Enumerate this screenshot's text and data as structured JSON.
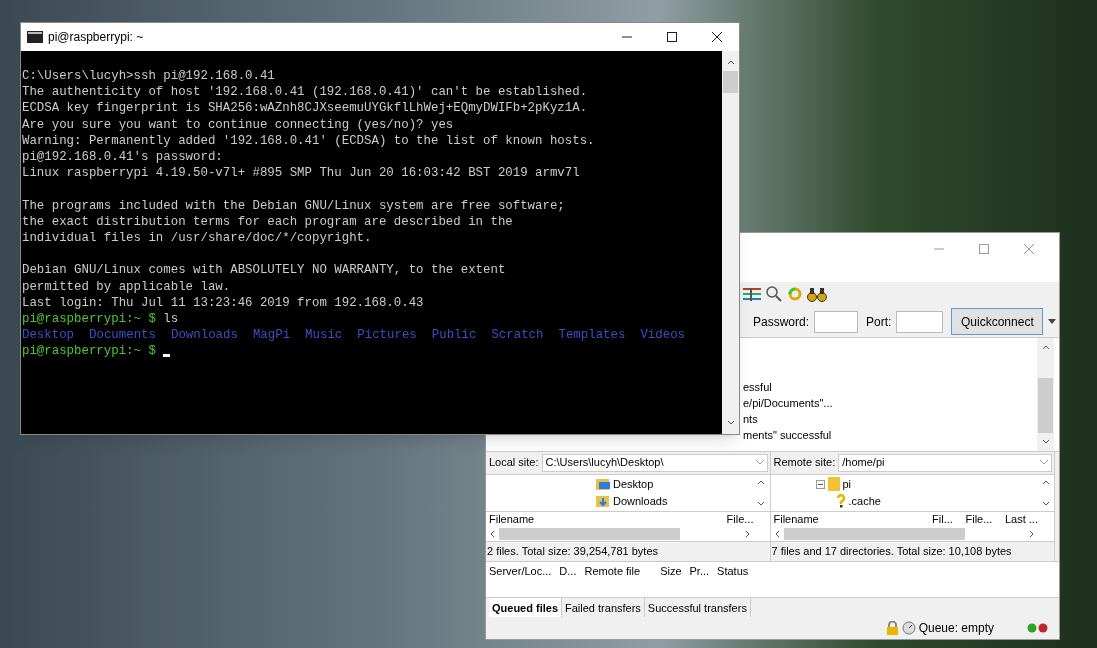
{
  "terminal": {
    "title": "pi@raspberrypi: ~",
    "lines": [
      {
        "kind": "output",
        "text": "C:\\Users\\lucyh>ssh pi@192.168.0.41"
      },
      {
        "kind": "output",
        "text": "The authenticity of host '192.168.0.41 (192.168.0.41)' can't be established."
      },
      {
        "kind": "output",
        "text": "ECDSA key fingerprint is SHA256:wAZnh8CJXseemuUYGkflLhWej+EQmyDWIFb+2pKyz1A."
      },
      {
        "kind": "output",
        "text": "Are you sure you want to continue connecting (yes/no)? yes"
      },
      {
        "kind": "output",
        "text": "Warning: Permanently added '192.168.0.41' (ECDSA) to the list of known hosts."
      },
      {
        "kind": "output",
        "text": "pi@192.168.0.41's password:"
      },
      {
        "kind": "output",
        "text": "Linux raspberrypi 4.19.50-v7l+ #895 SMP Thu Jun 20 16:03:42 BST 2019 armv7l"
      },
      {
        "kind": "blank"
      },
      {
        "kind": "output",
        "text": "The programs included with the Debian GNU/Linux system are free software;"
      },
      {
        "kind": "output",
        "text": "the exact distribution terms for each program are described in the"
      },
      {
        "kind": "output",
        "text": "individual files in /usr/share/doc/*/copyright."
      },
      {
        "kind": "blank"
      },
      {
        "kind": "output",
        "text": "Debian GNU/Linux comes with ABSOLUTELY NO WARRANTY, to the extent"
      },
      {
        "kind": "output",
        "text": "permitted by applicable law."
      },
      {
        "kind": "output",
        "text": "Last login: Thu Jul 11 13:23:46 2019 from 192.168.0.43"
      },
      {
        "kind": "prompt",
        "prompt": "pi@raspberrypi:~ $",
        "command": "ls",
        "cursor": false
      },
      {
        "kind": "listing",
        "items": [
          "Desktop",
          "Documents",
          "Downloads",
          "MagPi",
          "Music",
          "Pictures",
          "Public",
          "Scratch",
          "Templates",
          "Videos"
        ]
      },
      {
        "kind": "prompt",
        "prompt": "pi@raspberrypi:~ $",
        "cursor": true
      }
    ]
  },
  "filezilla": {
    "quickconnect": {
      "password_label": "Password:",
      "port_label": "Port:",
      "button": "Quickconnect"
    },
    "log": [
      "essful",
      "e/pi/Documents\"...",
      "nts",
      "ments\" successful"
    ],
    "local": {
      "site_label": "Local site:",
      "site_value": "C:\\Users\\lucyh\\Desktop\\",
      "tree": [
        {
          "kind": "desktop-folder",
          "label": "Desktop"
        },
        {
          "kind": "download-folder",
          "label": "Downloads"
        }
      ],
      "columns": [
        "Filename",
        "File..."
      ],
      "status": "2 files. Total size: 39,254,781 bytes"
    },
    "remote": {
      "site_label": "Remote site:",
      "site_value": "/home/pi",
      "tree": [
        {
          "kind": "folder",
          "label": "pi"
        },
        {
          "kind": "unknown",
          "label": ".cache"
        }
      ],
      "columns": [
        "Filename",
        "Fil...",
        "File...",
        "Last ..."
      ],
      "status": "7 files and 17 directories. Total size: 10,108 bytes"
    },
    "queue_columns": [
      "Server/Loc...",
      "D...",
      "Remote file",
      "Size",
      "Pr...",
      "Status"
    ],
    "tabs": [
      {
        "label": "Queued files",
        "selected": true
      },
      {
        "label": "Failed transfers",
        "selected": false
      },
      {
        "label": "Successful transfers",
        "selected": false
      }
    ],
    "queue_status": "Queue: empty"
  }
}
